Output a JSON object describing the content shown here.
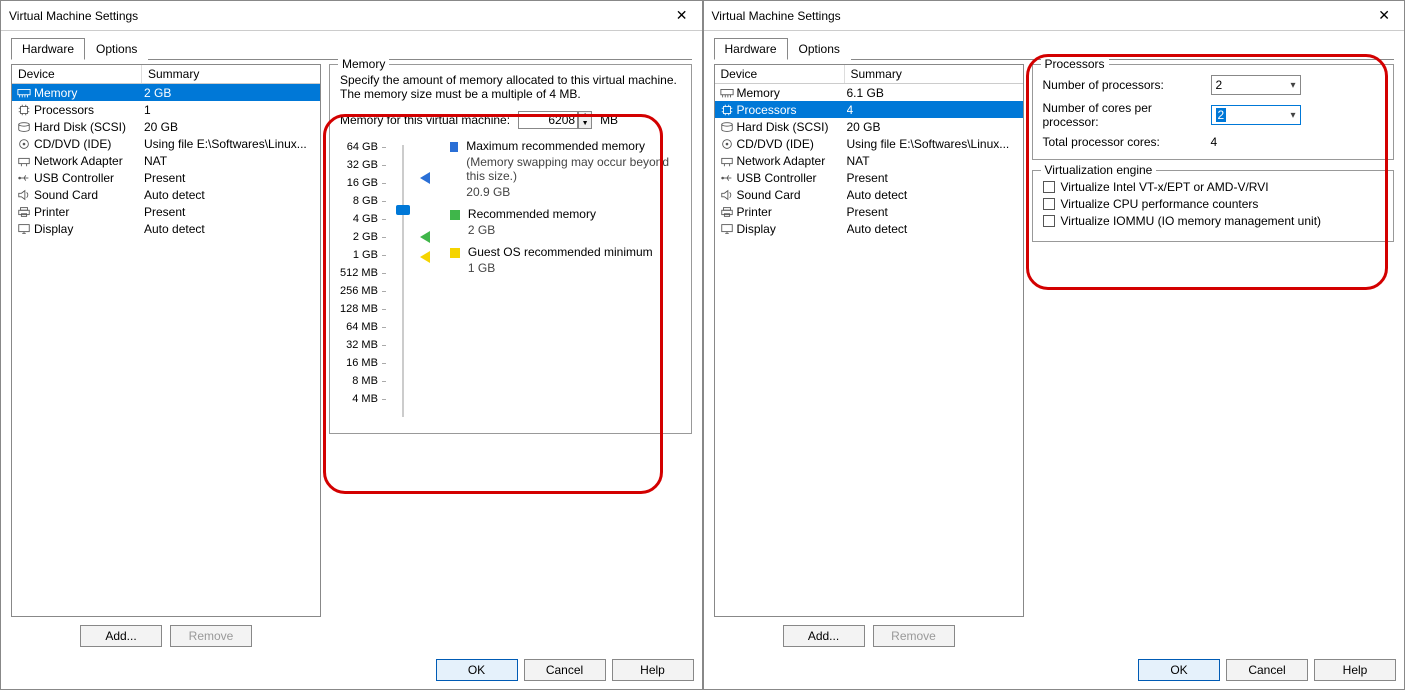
{
  "left": {
    "title": "Virtual Machine Settings",
    "tabs": {
      "hardware": "Hardware",
      "options": "Options"
    },
    "table": {
      "h_device": "Device",
      "h_summary": "Summary"
    },
    "devices": [
      {
        "name": "Memory",
        "summary": "2 GB"
      },
      {
        "name": "Processors",
        "summary": "1"
      },
      {
        "name": "Hard Disk (SCSI)",
        "summary": "20 GB"
      },
      {
        "name": "CD/DVD (IDE)",
        "summary": "Using file E:\\Softwares\\Linux..."
      },
      {
        "name": "Network Adapter",
        "summary": "NAT"
      },
      {
        "name": "USB Controller",
        "summary": "Present"
      },
      {
        "name": "Sound Card",
        "summary": "Auto detect"
      },
      {
        "name": "Printer",
        "summary": "Present"
      },
      {
        "name": "Display",
        "summary": "Auto detect"
      }
    ],
    "selected_index": 0,
    "buttons": {
      "add": "Add...",
      "remove": "Remove"
    },
    "memory": {
      "group": "Memory",
      "desc": "Specify the amount of memory allocated to this virtual machine. The memory size must be a multiple of 4 MB.",
      "label": "Memory for this virtual machine:",
      "value": "6208",
      "unit": "MB",
      "ticks": [
        "64 GB",
        "32 GB",
        "16 GB",
        "8 GB",
        "4 GB",
        "2 GB",
        "1 GB",
        "512 MB",
        "256 MB",
        "128 MB",
        "64 MB",
        "32 MB",
        "16 MB",
        "8 MB",
        "4 MB"
      ],
      "max_label": "Maximum recommended memory",
      "max_note": "(Memory swapping may occur beyond this size.)",
      "max_val": "20.9 GB",
      "rec_label": "Recommended memory",
      "rec_val": "2 GB",
      "min_label": "Guest OS recommended minimum",
      "min_val": "1 GB"
    },
    "footer": {
      "ok": "OK",
      "cancel": "Cancel",
      "help": "Help"
    }
  },
  "right": {
    "title": "Virtual Machine Settings",
    "tabs": {
      "hardware": "Hardware",
      "options": "Options"
    },
    "table": {
      "h_device": "Device",
      "h_summary": "Summary"
    },
    "devices": [
      {
        "name": "Memory",
        "summary": "6.1 GB"
      },
      {
        "name": "Processors",
        "summary": "4"
      },
      {
        "name": "Hard Disk (SCSI)",
        "summary": "20 GB"
      },
      {
        "name": "CD/DVD (IDE)",
        "summary": "Using file E:\\Softwares\\Linux..."
      },
      {
        "name": "Network Adapter",
        "summary": "NAT"
      },
      {
        "name": "USB Controller",
        "summary": "Present"
      },
      {
        "name": "Sound Card",
        "summary": "Auto detect"
      },
      {
        "name": "Printer",
        "summary": "Present"
      },
      {
        "name": "Display",
        "summary": "Auto detect"
      }
    ],
    "selected_index": 1,
    "buttons": {
      "add": "Add...",
      "remove": "Remove"
    },
    "proc": {
      "group": "Processors",
      "num_label": "Number of processors:",
      "num_val": "2",
      "cores_label": "Number of cores per processor:",
      "cores_val": "2",
      "total_label": "Total processor cores:",
      "total_val": "4"
    },
    "virt": {
      "group": "Virtualization engine",
      "opt1": "Virtualize Intel VT-x/EPT or AMD-V/RVI",
      "opt2": "Virtualize CPU performance counters",
      "opt3": "Virtualize IOMMU (IO memory management unit)"
    },
    "footer": {
      "ok": "OK",
      "cancel": "Cancel",
      "help": "Help"
    }
  }
}
